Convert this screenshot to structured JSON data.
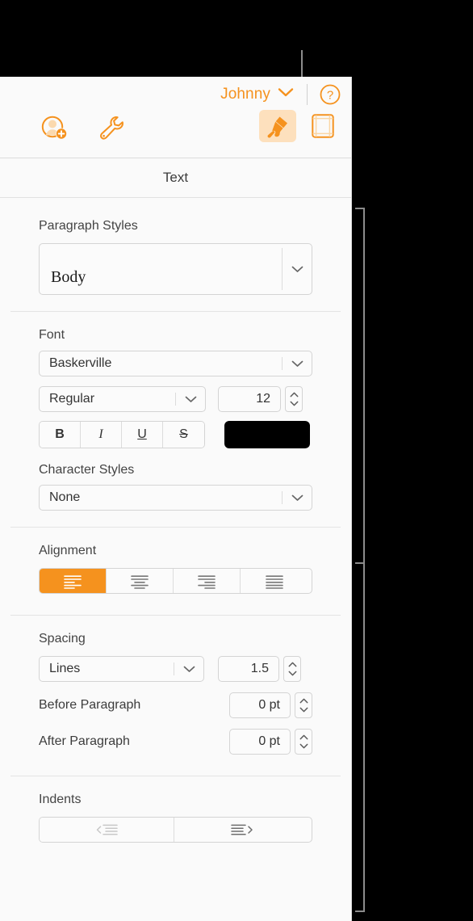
{
  "window": {
    "account_name": "Johnny",
    "help_label": "?"
  },
  "toolbar": {
    "collaborate_icon": "add-person-icon",
    "tools_icon": "wrench-icon",
    "format_icon": "paintbrush-icon",
    "document_icon": "document-layout-icon"
  },
  "panel": {
    "tab_label": "Text"
  },
  "paragraph_styles": {
    "title": "Paragraph Styles",
    "value": "Body"
  },
  "font": {
    "title": "Font",
    "family": "Baskerville",
    "style": "Regular",
    "size": "12",
    "bold_label": "B",
    "italic_label": "I",
    "underline_label": "U",
    "strikethrough_label": "S",
    "color": "#000000"
  },
  "character_styles": {
    "title": "Character Styles",
    "value": "None"
  },
  "alignment": {
    "title": "Alignment",
    "options": [
      {
        "name": "align-left",
        "selected": true
      },
      {
        "name": "align-center",
        "selected": false
      },
      {
        "name": "align-right",
        "selected": false
      },
      {
        "name": "align-justify",
        "selected": false
      }
    ]
  },
  "spacing": {
    "title": "Spacing",
    "mode": "Lines",
    "value": "1.5",
    "before_paragraph_label": "Before Paragraph",
    "before_paragraph_value": "0 pt",
    "after_paragraph_label": "After Paragraph",
    "after_paragraph_value": "0 pt"
  },
  "indents": {
    "title": "Indents",
    "decrease_icon": "decrease-indent-icon",
    "increase_icon": "increase-indent-icon"
  },
  "colors": {
    "accent": "#f5921e",
    "accent_soft": "#fde0bd",
    "panel_bg": "#fafafa",
    "callout": "#8c8c8c"
  }
}
